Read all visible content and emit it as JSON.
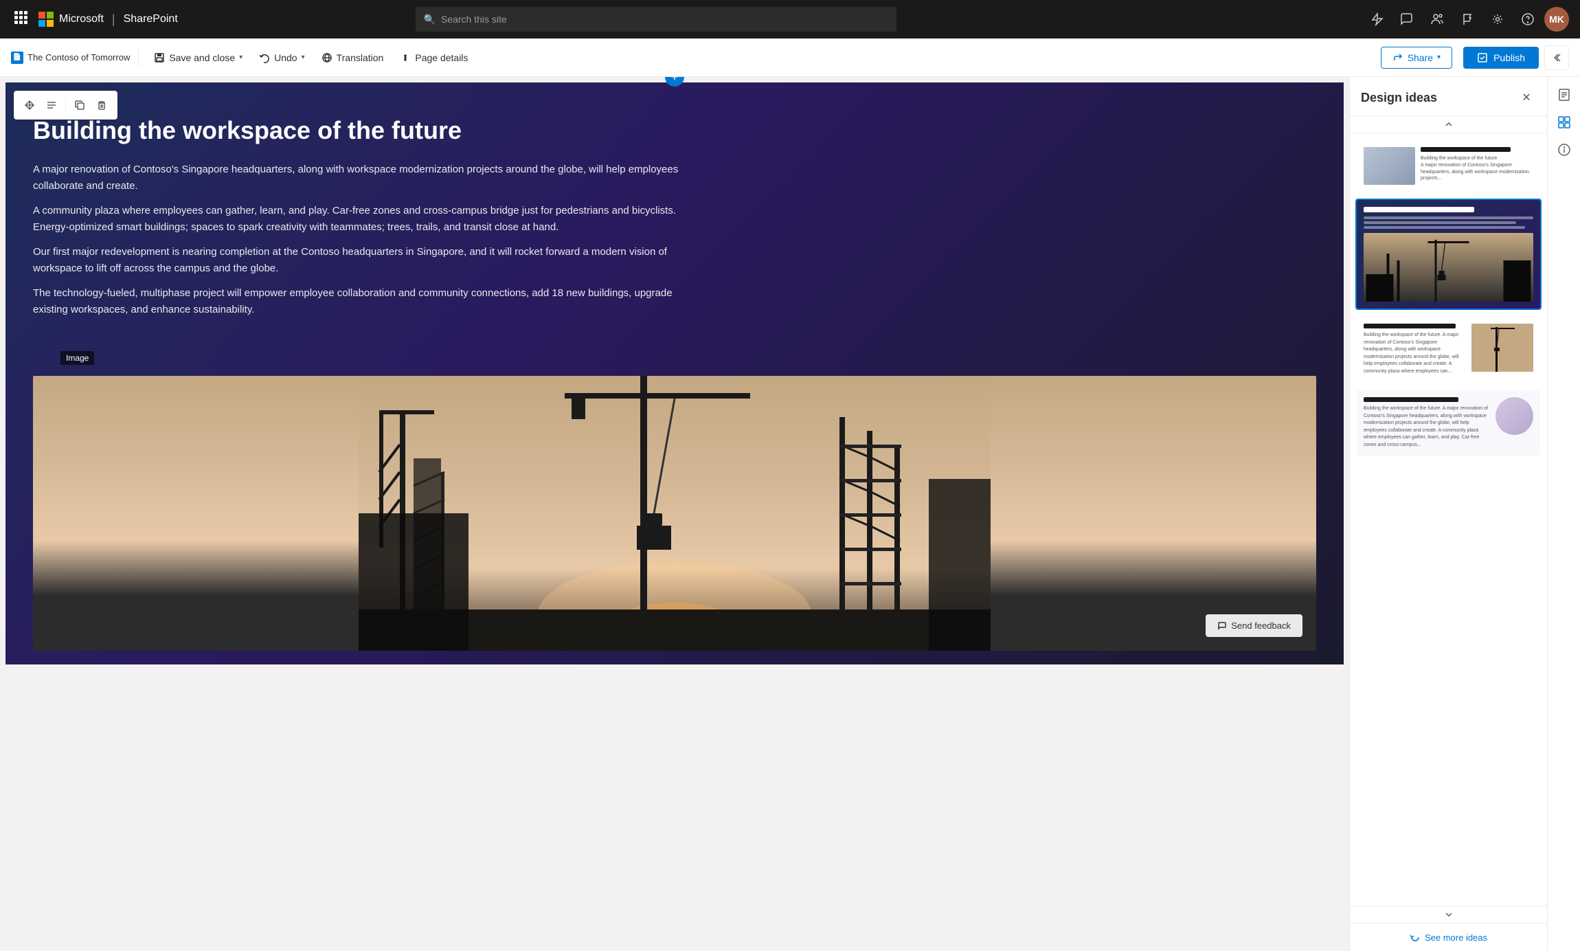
{
  "app": {
    "company": "Microsoft",
    "product": "SharePoint"
  },
  "topnav": {
    "waffle_label": "⊞",
    "search_placeholder": "Search this site",
    "icons": [
      "command",
      "chat",
      "people",
      "flag",
      "settings",
      "help"
    ]
  },
  "toolbar": {
    "page_name": "The Contoso of Tomorrow",
    "save_close_label": "Save and close",
    "undo_label": "Undo",
    "translation_label": "Translation",
    "page_details_label": "Page details",
    "share_label": "Share",
    "publish_label": "Publish"
  },
  "floating_toolbar": {
    "move_icon": "✥",
    "settings_icon": "≡",
    "copy_icon": "⧉",
    "delete_icon": "🗑"
  },
  "hero": {
    "title": "Building the workspace of the future",
    "body_paragraphs": [
      "A major renovation of Contoso's Singapore headquarters, along with workspace modernization projects around the globe, will help employees collaborate and create.",
      "A community plaza where employees can gather, learn, and play. Car-free zones and cross-campus bridge just for pedestrians and bicyclists. Energy-optimized smart buildings; spaces to spark creativity with teammates; trees, trails, and transit close at hand.",
      "Our first major redevelopment is nearing completion at the Contoso headquarters in Singapore, and it will rocket forward a modern vision of workspace to lift off across the campus and the globe.",
      "The technology-fueled, multiphase project will empower employee collaboration and community connections, add 18 new buildings, upgrade existing workspaces, and enhance sustainability."
    ],
    "image_label": "Image",
    "send_feedback_label": "Send feedback"
  },
  "design_panel": {
    "title": "Design ideas",
    "close_icon": "✕",
    "templates": [
      {
        "id": "tpl1",
        "selected": false
      },
      {
        "id": "tpl2",
        "selected": true
      },
      {
        "id": "tpl3",
        "selected": false
      },
      {
        "id": "tpl4",
        "selected": false
      }
    ],
    "see_more_label": "See more ideas",
    "refresh_icon": "↻"
  },
  "add_section": {
    "icon": "+"
  }
}
